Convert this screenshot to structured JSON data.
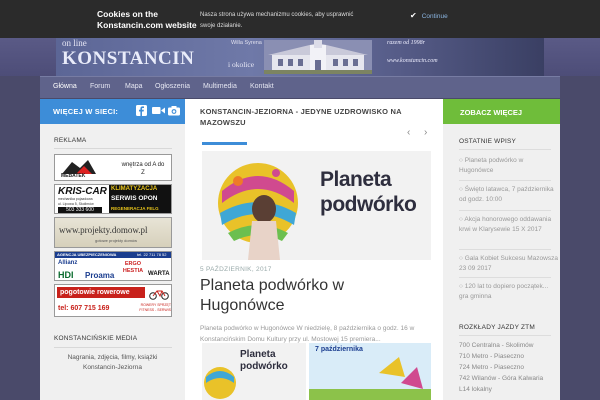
{
  "cookie": {
    "title": "Cookies on the Konstancin.com website",
    "text": "Nasza strona używa mechanizmu cookies, aby usprawnić swoje działanie.",
    "accept_label": "Continue"
  },
  "banner": {
    "online": "on line",
    "logo": "KONSTANCIN",
    "okolice": "i okolice",
    "villa": "Willa Syrena",
    "razem": "razem od 1998r",
    "www": "www.konstancin.com"
  },
  "nav": {
    "items": [
      {
        "label": "Główna"
      },
      {
        "label": "Forum"
      },
      {
        "label": "Mapa"
      },
      {
        "label": "Ogłoszenia"
      },
      {
        "label": "Multimedia"
      },
      {
        "label": "Kontakt"
      }
    ]
  },
  "left": {
    "header": "WIĘCEJ W SIECI:",
    "reklama": "REKLAMA",
    "ads": {
      "meba": {
        "brand": "MEBATEK",
        "text": "wnętrza od A do Z"
      },
      "kris": {
        "brand": "KRIS-CAR",
        "sub": "mechanika pojazdowa",
        "addr": "ul. Lipowa 5, Skolimów",
        "phone": "503 333 600",
        "right1": "KLIMATYZACJA",
        "right2": "SERWIS OPON",
        "right3": "REGENERACJA FELG"
      },
      "projekty": {
        "text": "www.projekty.domow.pl",
        "sub": "gotowe projekty domów"
      },
      "ubezp": {
        "header": "AGENCJA UBEZPIECZENIOWA",
        "tel": "tel. 22 711 78 52",
        "logos": [
          "Allianz",
          "HDI",
          "Proama",
          "ERGO HESTIA",
          "WARTA"
        ]
      },
      "pogotowie": {
        "title": "pogotowie rowerowe",
        "phone": "tel: 607 715 169",
        "sub": "ROWERY SPRZĘT FITNESS - SERWIS"
      }
    },
    "media_title": "KONSTANCIŃSKIE MEDIA",
    "media_text": "Nagrania, zdjęcia, filmy, książki Konstancin-Jeziorna"
  },
  "mid": {
    "title": "KONSTANCIN-JEZIORNA - JEDYNE UZDROWISKO NA MAZOWSZU",
    "prev": "‹",
    "next": "›",
    "hero_title": "Planeta podwórko",
    "date": "5 PAŹDZIERNIK, 2017",
    "post_title": "Planeta podwórko w Hugonówce",
    "excerpt": "Planeta podwórko w Hugonówce W niedzielę, 8 października o godz. 16 w Konstancińskim Domu Kultury przy ul. Mostowej 15 premiera...",
    "thumb1_title": "Planeta podwórko",
    "thumb2_title": "7 października"
  },
  "right": {
    "header": "ZOBACZ WIĘCEJ",
    "recent_title": "OSTATNIE WPISY",
    "recent": [
      "Planeta podwórko w Hugonówce",
      "Święto latawca, 7 października od godz. 10:00",
      "Akcja honorowego oddawania krwi w Klarysewie 15 X 2017",
      "Gala Kobiet Sukcesu Mazowsza 23 09 2017",
      "120 lat to dopiero początek... gra gminna"
    ],
    "ztm_title": "ROZKŁADY JAZDY ZTM",
    "ztm": [
      "700 Centralna - Skolimów",
      "710 Metro - Piaseczno",
      "724 Metro - Piaseczno",
      "742 Wilanów - Góra Kalwaria",
      "L14 lokalny"
    ]
  },
  "colors": {
    "blue": "#3d8dd8",
    "green": "#6fbd3a",
    "nav": "#5f638b"
  }
}
